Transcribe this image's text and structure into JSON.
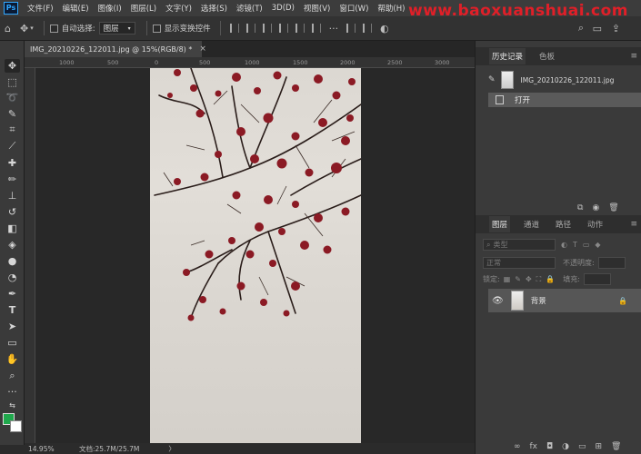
{
  "menubar": {
    "items": [
      "文件(F)",
      "编辑(E)",
      "图像(I)",
      "图层(L)",
      "文字(Y)",
      "选择(S)",
      "滤镜(T)",
      "3D(D)",
      "视图(V)",
      "窗口(W)",
      "帮助(H)"
    ],
    "watermark": "www.baoxuanshuai.com"
  },
  "options": {
    "auto_select_label": "自动选择:",
    "auto_select_value": "图层",
    "show_transform_label": "显示变换控件"
  },
  "document": {
    "tab_title": "IMG_20210226_122011.jpg @ 15%(RGB/8) *",
    "close_glyph": "×"
  },
  "ruler": {
    "top_ticks": [
      "1000",
      "500",
      "0",
      "500",
      "1000",
      "1500",
      "2000",
      "2500",
      "3000"
    ]
  },
  "status": {
    "zoom": "14.95%",
    "doc_size": "文档:25.7M/25.7M",
    "arrow": "〉"
  },
  "history_panel": {
    "tabs": [
      "历史记录",
      "色板"
    ],
    "snapshot_name": "IMG_20210226_122011.jpg",
    "step_name": "打开"
  },
  "layers_panel": {
    "tabs": [
      "图层",
      "通道",
      "路径",
      "动作"
    ],
    "filter_kind": "类型",
    "blend_mode": "正常",
    "opacity_label": "不透明度:",
    "lock_label": "锁定:",
    "fill_label": "填充:",
    "layer_name": "背景"
  },
  "colors": {
    "foreground": "#1fa84c",
    "background": "#ffffff",
    "accent": "#31a8ff",
    "watermark": "#e01f28"
  },
  "icons": [
    "move-icon",
    "marquee-icon",
    "lasso-icon",
    "quick-select-icon",
    "crop-icon",
    "eyedropper-icon",
    "healing-brush-icon",
    "brush-icon",
    "clone-stamp-icon",
    "history-brush-icon",
    "eraser-icon",
    "paint-bucket-icon",
    "blur-icon",
    "dodge-icon",
    "pen-icon",
    "type-icon",
    "path-select-icon",
    "rectangle-icon",
    "hand-icon",
    "zoom-icon"
  ]
}
